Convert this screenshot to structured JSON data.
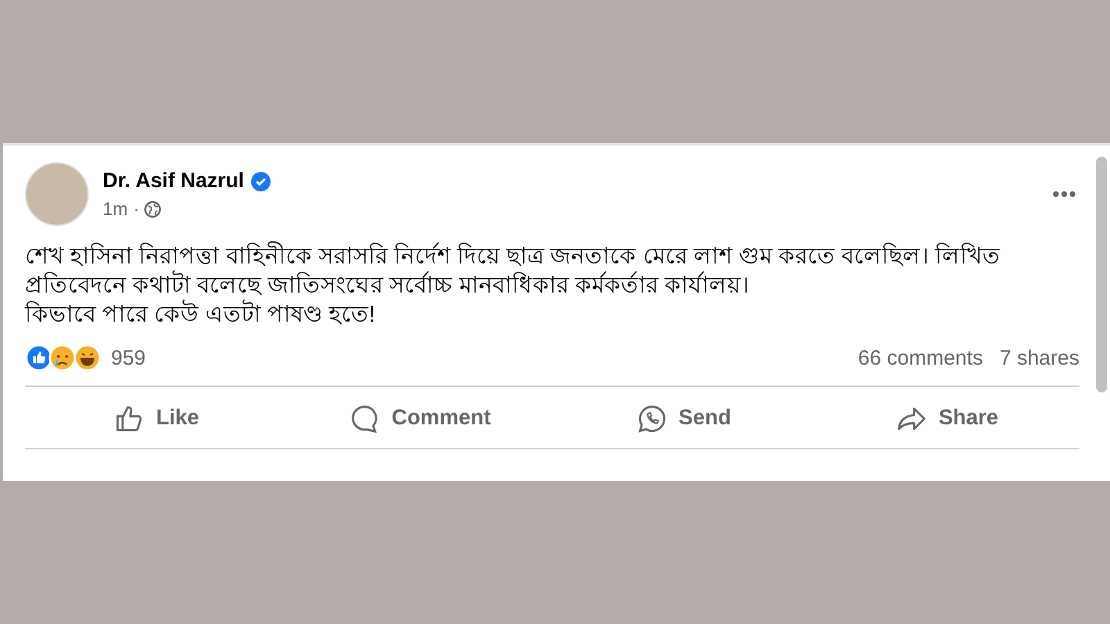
{
  "post": {
    "author": "Dr. Asif Nazrul",
    "verified": true,
    "time": "1m",
    "separator": "·",
    "paragraphs": [
      "শেখ হাসিনা নিরাপত্তা বাহিনীকে সরাসরি নির্দেশ দিয়ে ছাত্র জনতাকে মেরে লাশ গুম করতে বলেছিল। লিখিত প্রতিবেদনে কথাটা বলেছে জাতিসংঘের সর্বোচ্চ মানবাধিকার কর্মকর্তার কার্যালয়।",
      "কিভাবে পারে কেউ এতটা পাষণ্ড হতে!"
    ],
    "reactions": {
      "count": "959",
      "comments": "66 comments",
      "shares": "7 shares"
    },
    "actions": [
      {
        "kind": "like",
        "label": "Like"
      },
      {
        "kind": "comment",
        "label": "Comment"
      },
      {
        "kind": "send",
        "label": "Send"
      },
      {
        "kind": "share",
        "label": "Share"
      }
    ]
  }
}
